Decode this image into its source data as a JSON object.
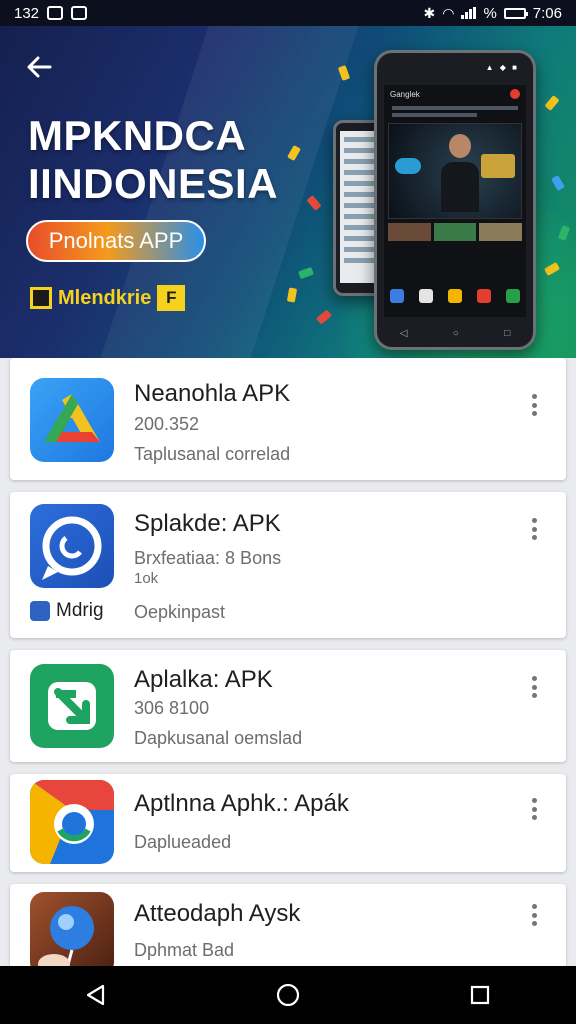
{
  "status_bar": {
    "time_left": "132",
    "time_right": "7:06",
    "percent_glyph": "%"
  },
  "hero": {
    "back_icon": "arrow-left-icon",
    "title_line1": "MPKNDCA",
    "title_line2": "IINDONESIA",
    "pill_label": "Pnolnats APP",
    "badge_label": "Mlendkrie",
    "badge_box": "F",
    "phone_title": "Ganglek",
    "colors": {
      "pill_start": "#e84d2a",
      "pill_end": "#2a8fe8",
      "badge": "#f7d21c"
    }
  },
  "apps": [
    {
      "name": "Neanohla APK",
      "line1": "200.352",
      "line2": "Taplusanal correlad",
      "icon": "google-drive-icon"
    },
    {
      "name": "Splakde: APK",
      "line1": "Brxfeatiaa: 8 Bons",
      "line2": "1ok",
      "line3": "Oepkinpast",
      "extra": "Mdrig",
      "icon": "chat-bubble-icon"
    },
    {
      "name": "Aplalka: APK",
      "line1": "306 8100",
      "line2": "Dapkusanal oemslad",
      "icon": "green-arrow-icon"
    },
    {
      "name": "Aptlnna Aphk.: Apák",
      "line1": "Daplueaded",
      "icon": "chrome-icon"
    },
    {
      "name": "Atteodaph Aysk",
      "line1": "Dphmat Bad",
      "icon": "balloon-icon"
    }
  ],
  "nav": {
    "back": "back-icon",
    "home": "home-icon",
    "recents": "recents-icon"
  }
}
